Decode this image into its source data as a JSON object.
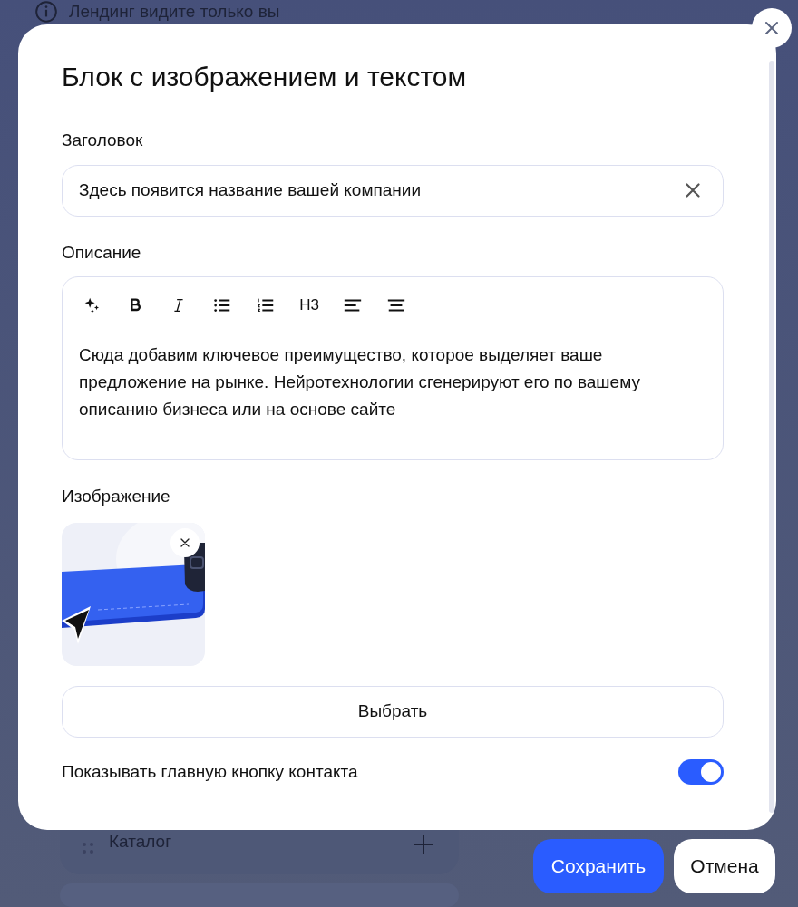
{
  "background": {
    "notice": "Лендинг видите только вы",
    "list_item": "Каталог"
  },
  "dialog": {
    "title": "Блок с изображением и текстом",
    "heading_field": {
      "label": "Заголовок",
      "value": "Здесь появится название вашей компании"
    },
    "description": {
      "label": "Описание",
      "toolbar": [
        {
          "kind": "sparkle"
        },
        {
          "kind": "bold"
        },
        {
          "kind": "italic"
        },
        {
          "kind": "bullets"
        },
        {
          "kind": "numbered"
        },
        {
          "kind": "heading",
          "text": "H3"
        },
        {
          "kind": "align-left"
        },
        {
          "kind": "align-center"
        }
      ],
      "text": "Сюда добавим ключевое преимущество, которое выделяет ваше предложение на рынке. Нейротехнологии сгенерируют его по вашему описанию бизнеса или на основе сайте"
    },
    "image": {
      "label": "Изображение",
      "kind": "picture",
      "choose_button": "Выбрать"
    },
    "contact_toggle": {
      "label": "Показывать главную кнопку контакта",
      "on": true
    }
  },
  "buttons": [
    {
      "kind": "primary",
      "label": "Сохранить"
    },
    {
      "kind": "secondary",
      "label": "Отмена"
    }
  ]
}
